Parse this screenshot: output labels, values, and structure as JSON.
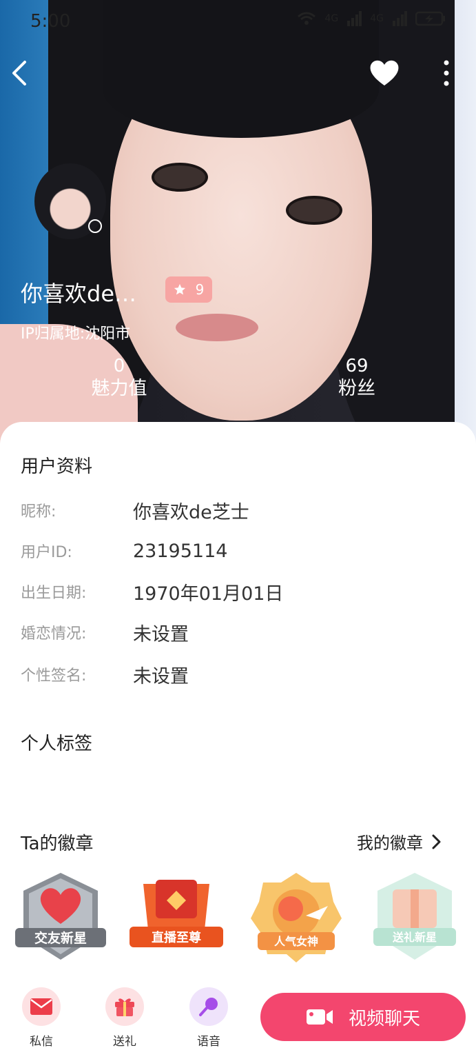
{
  "status_bar": {
    "time": "5:00",
    "net1": "4G",
    "net2": "4G"
  },
  "profile": {
    "nickname_short": "你喜欢de…",
    "level": "9",
    "ip_location": "IP归属地:沈阳市",
    "stats": [
      {
        "value": "0",
        "label": "魅力值"
      },
      {
        "value": "69",
        "label": "粉丝"
      }
    ]
  },
  "user_info": {
    "title": "用户资料",
    "rows": [
      {
        "key": "昵称:",
        "value": "你喜欢de芝士"
      },
      {
        "key": "用户ID:",
        "value": "23195114"
      },
      {
        "key": "出生日期:",
        "value": "1970年01月01日"
      },
      {
        "key": "婚恋情况:",
        "value": "未设置"
      },
      {
        "key": "个性签名:",
        "value": "未设置"
      }
    ]
  },
  "tags": {
    "title": "个人标签"
  },
  "badges": {
    "title": "Ta的徽章",
    "my_badges_link": "我的徽章",
    "items": [
      {
        "name": "交友新星",
        "color": "#e8424a"
      },
      {
        "name": "直播至尊",
        "color": "#f0632d"
      },
      {
        "name": "人气女神",
        "color": "#f3a34a"
      },
      {
        "name": "送礼新星",
        "color": "#9ed8c2"
      }
    ]
  },
  "actions": {
    "message": "私信",
    "gift": "送礼",
    "voice": "语音",
    "video_chat": "视频聊天"
  },
  "colors": {
    "accent": "#f3466e",
    "level_badge": "#f7a5a3"
  }
}
